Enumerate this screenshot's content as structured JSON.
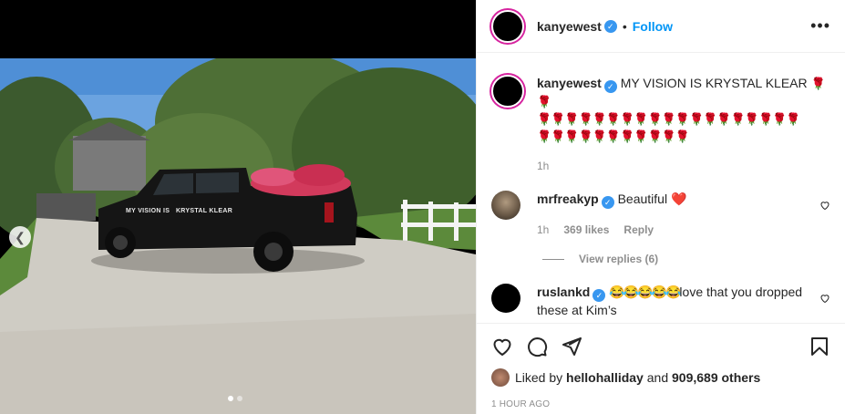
{
  "post": {
    "author": "kanyewest",
    "follow_label": "Follow",
    "separator": "•",
    "more_label": "•••"
  },
  "caption": {
    "username": "kanyewest",
    "text": "MY VISION IS KRYSTAL KLEAR",
    "roses_line1": "🌹🌹",
    "roses_line2": "🌹🌹🌹🌹🌹🌹🌹🌹🌹🌹🌹🌹🌹🌹🌹🌹🌹🌹🌹",
    "roses_line3": "🌹🌹🌹🌹🌹🌹🌹🌹🌹🌹🌹",
    "time": "1h"
  },
  "comments": [
    {
      "username": "mrfreakyp",
      "text": "Beautiful",
      "emoji": "❤️",
      "time": "1h",
      "likes": "369 likes",
      "reply": "Reply",
      "view_replies": "View replies (6)"
    },
    {
      "username": "ruslankd",
      "emoji": "😂😂😂😂😂",
      "text": "love that you dropped these at Kim’s"
    }
  ],
  "truck_decal": "MY VISION IS   KRYSTAL KLEAR",
  "likes": {
    "prefix": "Liked by",
    "user": "hellohalliday",
    "mid": "and",
    "count": "909,689 others"
  },
  "timestamp": "1 HOUR AGO",
  "icons": {
    "verified": "verified-badge-icon",
    "heart": "heart-icon",
    "comment": "comment-icon",
    "share": "share-icon",
    "bookmark": "bookmark-icon"
  },
  "colors": {
    "follow": "#0095f6",
    "verified": "#3897f0",
    "muted": "#8e8e8e"
  }
}
